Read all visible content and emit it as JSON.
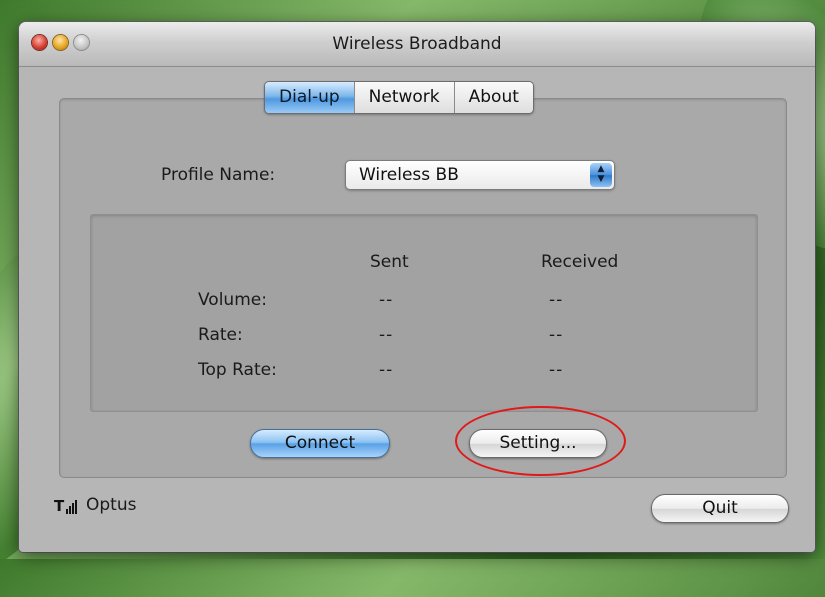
{
  "window": {
    "title": "Wireless Broadband"
  },
  "tabs": [
    {
      "label": "Dial-up",
      "active": true
    },
    {
      "label": "Network",
      "active": false
    },
    {
      "label": "About",
      "active": false
    }
  ],
  "profile": {
    "label": "Profile Name:",
    "value": "Wireless BB"
  },
  "stats": {
    "columns": [
      "Sent",
      "Received"
    ],
    "rows": [
      {
        "label": "Volume:",
        "sent": "--",
        "received": "--"
      },
      {
        "label": "Rate:",
        "sent": "--",
        "received": "--"
      },
      {
        "label": "Top Rate:",
        "sent": "--",
        "received": "--"
      }
    ]
  },
  "buttons": {
    "connect": "Connect",
    "setting": "Setting...",
    "quit": "Quit"
  },
  "status": {
    "carrier": "Optus",
    "signal_icon": "signal-strength-icon"
  },
  "colors": {
    "accent_blue": "#5aa2e6",
    "highlight_ring": "#e0191a"
  }
}
